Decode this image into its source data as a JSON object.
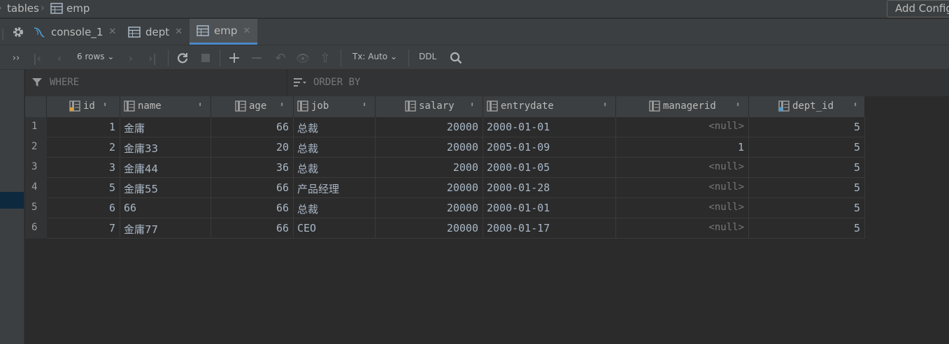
{
  "breadcrumb": {
    "parent": "tables",
    "table": "emp"
  },
  "toolbar_top": {
    "add_config": "Add Configuration..."
  },
  "tabs": [
    {
      "label": "console_1",
      "icon": "console-icon"
    },
    {
      "label": "dept",
      "icon": "table-icon"
    },
    {
      "label": "emp",
      "icon": "table-icon",
      "active": true
    }
  ],
  "toolbar": {
    "rows_label": "6 rows",
    "tx_label": "Tx: Auto",
    "ddl_label": "DDL"
  },
  "filter": {
    "where": "WHERE",
    "order_by": "ORDER BY"
  },
  "columns": [
    "id",
    "name",
    "age",
    "job",
    "salary",
    "entrydate",
    "managerid",
    "dept_id"
  ],
  "rows": [
    {
      "n": "1",
      "id": "1",
      "name": "金庸",
      "age": "66",
      "job": "总裁",
      "salary": "20000",
      "entrydate": "2000-01-01",
      "managerid": "<null>",
      "dept_id": "5"
    },
    {
      "n": "2",
      "id": "2",
      "name": "金庸33",
      "age": "20",
      "job": "总裁",
      "salary": "20000",
      "entrydate": "2005-01-09",
      "managerid": "1",
      "dept_id": "5"
    },
    {
      "n": "3",
      "id": "3",
      "name": "金庸44",
      "age": "36",
      "job": "总裁",
      "salary": "2000",
      "entrydate": "2000-01-05",
      "managerid": "<null>",
      "dept_id": "5"
    },
    {
      "n": "4",
      "id": "5",
      "name": "金庸55",
      "age": "66",
      "job": "产品经理",
      "salary": "20000",
      "entrydate": "2000-01-28",
      "managerid": "<null>",
      "dept_id": "5"
    },
    {
      "n": "5",
      "id": "6",
      "name": "66",
      "age": "66",
      "job": "总裁",
      "salary": "20000",
      "entrydate": "2000-01-01",
      "managerid": "<null>",
      "dept_id": "5"
    },
    {
      "n": "6",
      "id": "7",
      "name": "金庸77",
      "age": "66",
      "job": "CEO",
      "salary": "20000",
      "entrydate": "2000-01-17",
      "managerid": "<null>",
      "dept_id": "5"
    }
  ],
  "colors": {
    "accent": "#4a88c7",
    "null_text": "#787878",
    "cell_text": "#a9b7c6"
  }
}
